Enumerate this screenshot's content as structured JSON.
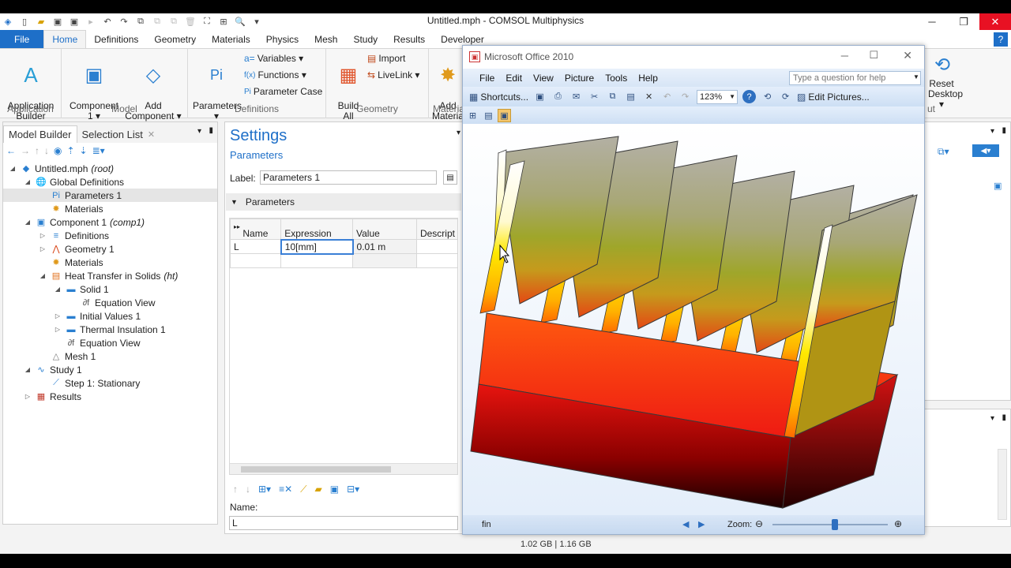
{
  "window": {
    "title": "Untitled.mph - COMSOL Multiphysics",
    "controls": {
      "minimize": "─",
      "maximize": "❐",
      "close": "✕"
    }
  },
  "ribbon_tabs": [
    "File",
    "Home",
    "Definitions",
    "Geometry",
    "Materials",
    "Physics",
    "Mesh",
    "Study",
    "Results",
    "Developer"
  ],
  "active_tab": "Home",
  "ribbon": {
    "application": {
      "label": "Application\nBuilder",
      "group": "Application"
    },
    "model": {
      "component": "Component\n1 ▾",
      "add_component": "Add\nComponent ▾",
      "group": "Model"
    },
    "definitions": {
      "parameters": "Parameters\n▾",
      "variables": "Variables ▾",
      "functions": "Functions ▾",
      "parameter_case": "Parameter Case",
      "group": "Definitions",
      "variables_prefix": "a=",
      "functions_prefix": "f(x)"
    },
    "geometry": {
      "build_all": "Build\nAll",
      "import": "Import",
      "livelink": "LiveLink ▾",
      "group": "Geometry"
    },
    "materials": {
      "add_material": "Add\nMateria",
      "group": "Materia"
    },
    "right": {
      "reset_desktop": "Reset\nDesktop ▾",
      "group": "ut"
    }
  },
  "model_builder": {
    "tab_active": "Model Builder",
    "tab_other": "Selection List",
    "tree": [
      {
        "label": "Untitled.mph",
        "suffix": "(root)",
        "level": 0,
        "arrow": "◢",
        "icon": "◆"
      },
      {
        "label": "Global Definitions",
        "suffix": "",
        "level": 1,
        "arrow": "◢",
        "icon": "🌐"
      },
      {
        "label": "Parameters 1",
        "suffix": "",
        "level": 2,
        "arrow": "",
        "icon": "Pi",
        "selected": true
      },
      {
        "label": "Materials",
        "suffix": "",
        "level": 2,
        "arrow": "",
        "icon": "✸"
      },
      {
        "label": "Component 1",
        "suffix": "(comp1)",
        "level": 1,
        "arrow": "◢",
        "icon": "▣"
      },
      {
        "label": "Definitions",
        "suffix": "",
        "level": 2,
        "arrow": "▷",
        "icon": "≡"
      },
      {
        "label": "Geometry 1",
        "suffix": "",
        "level": 2,
        "arrow": "▷",
        "icon": "⋀"
      },
      {
        "label": "Materials",
        "suffix": "",
        "level": 2,
        "arrow": "",
        "icon": "✸"
      },
      {
        "label": "Heat Transfer in Solids",
        "suffix": "(ht)",
        "level": 2,
        "arrow": "◢",
        "icon": "▤"
      },
      {
        "label": "Solid 1",
        "suffix": "",
        "level": 3,
        "arrow": "◢",
        "icon": "▬"
      },
      {
        "label": "Equation View",
        "suffix": "",
        "level": 4,
        "arrow": "",
        "icon": "∂f"
      },
      {
        "label": "Initial Values 1",
        "suffix": "",
        "level": 3,
        "arrow": "▷",
        "icon": "▬"
      },
      {
        "label": "Thermal Insulation 1",
        "suffix": "",
        "level": 3,
        "arrow": "▷",
        "icon": "▬"
      },
      {
        "label": "Equation View",
        "suffix": "",
        "level": 3,
        "arrow": "",
        "icon": "∂f"
      },
      {
        "label": "Mesh 1",
        "suffix": "",
        "level": 2,
        "arrow": "",
        "icon": "△"
      },
      {
        "label": "Study 1",
        "suffix": "",
        "level": 1,
        "arrow": "◢",
        "icon": "∿"
      },
      {
        "label": "Step 1: Stationary",
        "suffix": "",
        "level": 2,
        "arrow": "",
        "icon": "⟋"
      },
      {
        "label": "Results",
        "suffix": "",
        "level": 1,
        "arrow": "▷",
        "icon": "▦"
      }
    ]
  },
  "settings": {
    "title": "Settings",
    "subtitle": "Parameters",
    "label_caption": "Label:",
    "label_value": "Parameters 1",
    "section": "Parameters",
    "table": {
      "headers": [
        "Name",
        "Expression",
        "Value",
        "Descript"
      ],
      "rows": [
        [
          "L",
          "10[mm]",
          "0.01 m",
          ""
        ]
      ]
    },
    "name_caption": "Name:",
    "name_value": "L"
  },
  "office_window": {
    "title": "Microsoft Office 2010",
    "menu": [
      "File",
      "Edit",
      "View",
      "Picture",
      "Tools",
      "Help"
    ],
    "help_placeholder": "Type a question for help",
    "shortcuts": "Shortcuts...",
    "zoom_value": "123%",
    "edit_pictures": "Edit Pictures...",
    "status_name": "fin",
    "zoom_label": "Zoom:"
  },
  "statusbar": {
    "memory": "1.02 GB | 1.16 GB"
  },
  "colors": {
    "accent": "#1e6fc8",
    "close_red": "#e81123"
  }
}
